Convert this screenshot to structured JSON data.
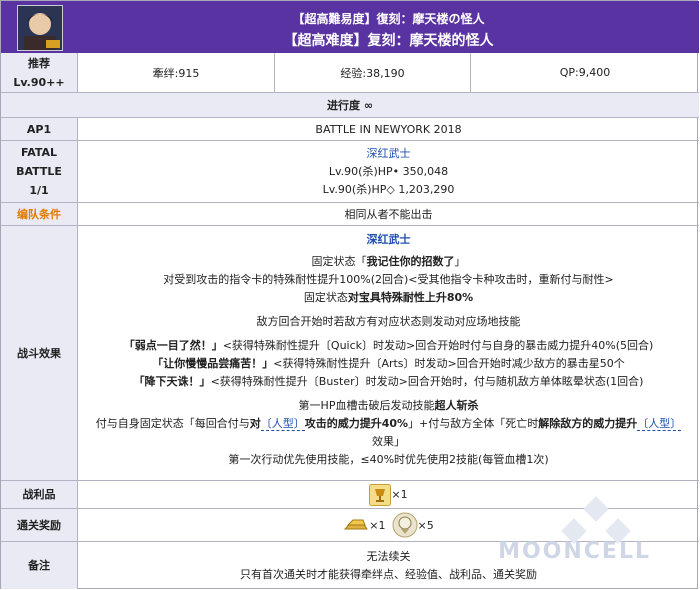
{
  "header": {
    "title_jp": "【超高難易度】復刻：摩天楼の怪人",
    "title_cn": "【超高难度】复刻：摩天楼的怪人",
    "icon": "servant-portrait-icon"
  },
  "recommend": {
    "label1": "推荐",
    "label2": "Lv.90++",
    "bond": "牽绊:915",
    "exp": "经验:38,190",
    "qp": "QP:9,400"
  },
  "progress": {
    "label": "进行度 ∞"
  },
  "ap": {
    "label": "AP1",
    "value": "BATTLE IN NEWYORK 2018"
  },
  "fatal": {
    "label1": "FATAL",
    "label2": "BATTLE",
    "label3": "1/1",
    "enemy_name": "深红武士",
    "hp1": "Lv.90(杀)HP• 350,048",
    "hp2": "Lv.90(杀)HP◇ 1,203,290"
  },
  "team": {
    "label": "编队条件",
    "value": "相同从者不能出击"
  },
  "battle": {
    "label": "战斗效果",
    "enemy_name": "深红武士",
    "l1a": "固定状态「",
    "l1b": "我记住你的招数了",
    "l1c": "」",
    "l2": "对受到攻击的指令卡的特殊耐性提升100%(2回合)<受其他指令卡种攻击时，重新付与耐性>",
    "l3a": "固定状态",
    "l3b": "对宝具特殊耐性上升80%",
    "l4": "敌方回合开始时若敌方有对应状态则发动对应场地技能",
    "l5a": "「弱点一目了然！」",
    "l5b": "<获得特殊耐性提升〔Quick〕时发动>回合开始时付与自身的暴击威力提升40%(5回合)",
    "l6a": "「让你慢慢品尝痛苦！」",
    "l6b": "<获得特殊耐性提升〔Arts〕时发动>回合开始时减少敌方的暴击星50个",
    "l7a": "「降下天诛！」",
    "l7b": "<获得特殊耐性提升〔Buster〕时发动>回合开始时，付与随机敌方单体眩晕状态(1回合)",
    "l8a": "第一HP血槽击破后发动技能",
    "l8b": "超人斩杀",
    "l9a": "付与自身固定状态「每回合付与",
    "l9b": "对",
    "l9c": "〔人型〕",
    "l9d": "攻击的威力提升40%",
    "l9e": "」+付与敌方全体「死亡时",
    "l9f": "解除敌方的威力提升",
    "l9g": "〔人型〕",
    "l10": "效果」",
    "l11": "第一次行动优先使用技能，≤40%时优先使用2技能(每管血槽1次)"
  },
  "loot": {
    "label": "战利品",
    "count": "×1",
    "icon": "golden-cup-icon"
  },
  "reward": {
    "label": "通关奖励",
    "count1": "×1",
    "count2": "×5",
    "icon1": "gold-bars-icon",
    "icon2": "saint-quartz-icon"
  },
  "notes": {
    "label": "备注",
    "line1": "无法续关",
    "line2": "只有首次通关时才能获得牵绊点、经验值、战利品、通关奖励"
  },
  "watermark": "MOONCELL",
  "colors": {
    "header": "#5a33a2",
    "label_bg": "#e9eaf3",
    "blue": "#1e4fb0",
    "orange": "#e07b00"
  }
}
